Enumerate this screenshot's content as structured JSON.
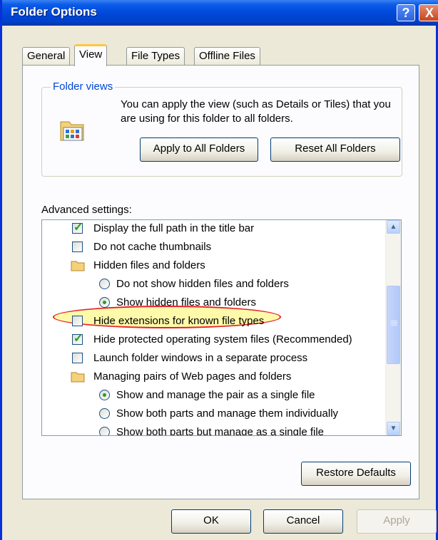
{
  "window": {
    "title": "Folder Options",
    "help_label": "?",
    "close_label": "X"
  },
  "tabs": [
    {
      "label": "General"
    },
    {
      "label": "View",
      "active": true
    },
    {
      "label": "File Types"
    },
    {
      "label": "Offline Files"
    }
  ],
  "folder_views": {
    "title": "Folder views",
    "description": "You can apply the view (such as Details or Tiles) that you are using for this folder to all folders.",
    "apply_all_label": "Apply to All Folders",
    "reset_all_label": "Reset All Folders"
  },
  "advanced": {
    "label": "Advanced settings:",
    "items": [
      {
        "type": "checkbox",
        "label": "Display the full path in the title bar",
        "checked": true,
        "indent": 1
      },
      {
        "type": "checkbox",
        "label": "Do not cache thumbnails",
        "checked": false,
        "indent": 1
      },
      {
        "type": "folder",
        "label": "Hidden files and folders",
        "indent": 1
      },
      {
        "type": "radio",
        "label": "Do not show hidden files and folders",
        "selected": false,
        "indent": 2
      },
      {
        "type": "radio",
        "label": "Show hidden files and folders",
        "selected": true,
        "indent": 2
      },
      {
        "type": "checkbox",
        "label": "Hide extensions for known file types",
        "checked": false,
        "indent": 1,
        "highlighted": true
      },
      {
        "type": "checkbox",
        "label": "Hide protected operating system files (Recommended)",
        "checked": true,
        "indent": 1
      },
      {
        "type": "checkbox",
        "label": "Launch folder windows in a separate process",
        "checked": false,
        "indent": 1
      },
      {
        "type": "folder",
        "label": "Managing pairs of Web pages and folders",
        "indent": 1
      },
      {
        "type": "radio",
        "label": "Show and manage the pair as a single file",
        "selected": true,
        "indent": 2
      },
      {
        "type": "radio",
        "label": "Show both parts and manage them individually",
        "selected": false,
        "indent": 2
      },
      {
        "type": "radio",
        "label": "Show both parts but manage as a single file",
        "selected": false,
        "indent": 2
      }
    ]
  },
  "buttons": {
    "restore_defaults": "Restore Defaults",
    "ok": "OK",
    "cancel": "Cancel",
    "apply": "Apply"
  },
  "colors": {
    "titlebar": "#0046d8",
    "highlight_fill": "#fff564",
    "highlight_stroke": "#e6222a",
    "check": "#21a121",
    "group_title": "#0046d5"
  }
}
